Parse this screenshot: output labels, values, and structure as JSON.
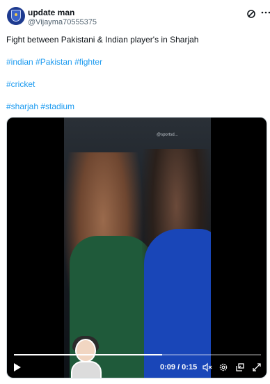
{
  "author": {
    "name": "update man",
    "handle": "@Vijayma70555375",
    "avatar_icon": "shield-badge-icon"
  },
  "actions": {
    "grok_icon": "grok-icon",
    "more_icon": "more-options-icon"
  },
  "tweet": {
    "text": "Fight between Pakistani & Indian player's in Sharjah",
    "hashtags_line1": "#indian #Pakistan #fighter",
    "hashtags_line2": "#cricket",
    "hashtags_line3": "#sharjah #stadium"
  },
  "video": {
    "current_time": "0:09",
    "duration": "0:15",
    "time_display": "0:09 / 0:15",
    "progress_fraction": 0.6,
    "watermark": "@sportsd..."
  },
  "colors": {
    "link": "#1d9bf0",
    "text": "#0f1419",
    "secondary": "#536471",
    "video_bg": "#000000"
  }
}
